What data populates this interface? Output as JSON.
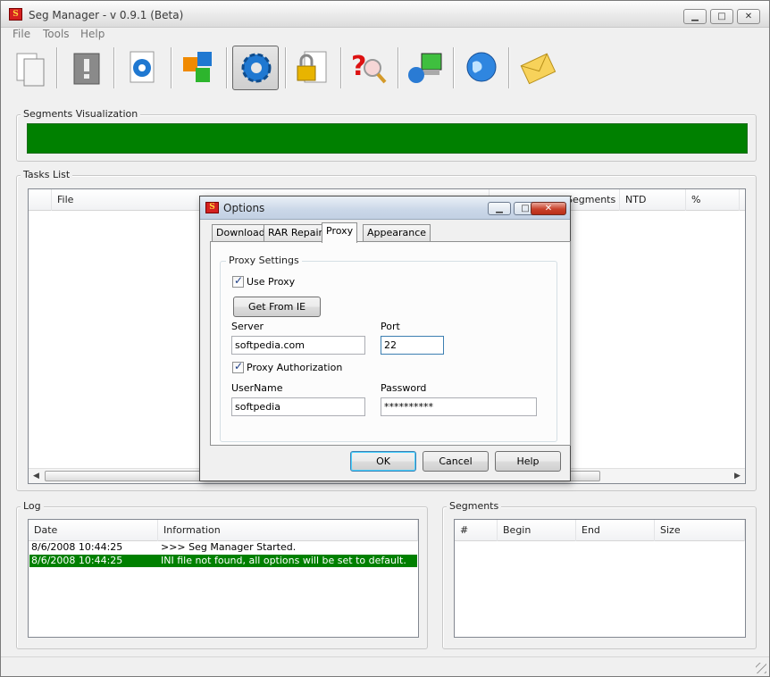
{
  "window": {
    "title": "Seg Manager - v 0.9.1 (Beta)",
    "app_icon_letter": "S",
    "controls": {
      "minimize": "▁",
      "maximize": "□",
      "close": "✕"
    }
  },
  "menu": [
    "File",
    "Tools",
    "Help"
  ],
  "toolbar": {
    "buttons": [
      {
        "icon": "new-document-icon"
      },
      {
        "icon": "error-document-icon"
      },
      {
        "icon": "document-settings-icon"
      },
      {
        "icon": "cubes-icon"
      },
      {
        "icon": "gear-icon",
        "active": true
      },
      {
        "icon": "lock-document-icon"
      },
      {
        "icon": "help-search-icon"
      },
      {
        "icon": "network-computer-icon"
      },
      {
        "icon": "globe-icon"
      },
      {
        "icon": "envelope-icon"
      }
    ]
  },
  "segments_visualization": {
    "label": "Segments Visualization",
    "color": "#008000"
  },
  "tasks_list": {
    "label": "Tasks List",
    "columns": [
      "File",
      "Segments",
      "NTD",
      "%"
    ]
  },
  "log": {
    "label": "Log",
    "columns": [
      "Date",
      "Information"
    ],
    "rows": [
      {
        "date": "8/6/2008 10:44:25",
        "info": ">>> Seg Manager Started.",
        "selected": false
      },
      {
        "date": "8/6/2008 10:44:25",
        "info": "INI file not found, all options will be set to default.",
        "selected": true
      }
    ]
  },
  "segments": {
    "label": "Segments",
    "columns": [
      "#",
      "Begin",
      "End",
      "Size"
    ]
  },
  "dialog": {
    "title": "Options",
    "tabs": [
      "Download",
      "RAR Repair",
      "Proxy",
      "Appearance"
    ],
    "active_tab": "Proxy",
    "proxy_settings_label": "Proxy Settings",
    "use_proxy_label": "Use Proxy",
    "use_proxy_checked": true,
    "get_from_ie_label": "Get From IE",
    "server_label": "Server",
    "server_value": "softpedia.com",
    "port_label": "Port",
    "port_value": "22",
    "proxy_auth_label": "Proxy Authorization",
    "proxy_auth_checked": true,
    "username_label": "UserName",
    "username_value": "softpedia",
    "password_label": "Password",
    "password_value": "**********",
    "ok_label": "OK",
    "cancel_label": "Cancel",
    "help_label": "Help",
    "check_mark": "✓"
  },
  "colors": {
    "selection": "#008000",
    "accent_blue": "#3c7fb1"
  }
}
